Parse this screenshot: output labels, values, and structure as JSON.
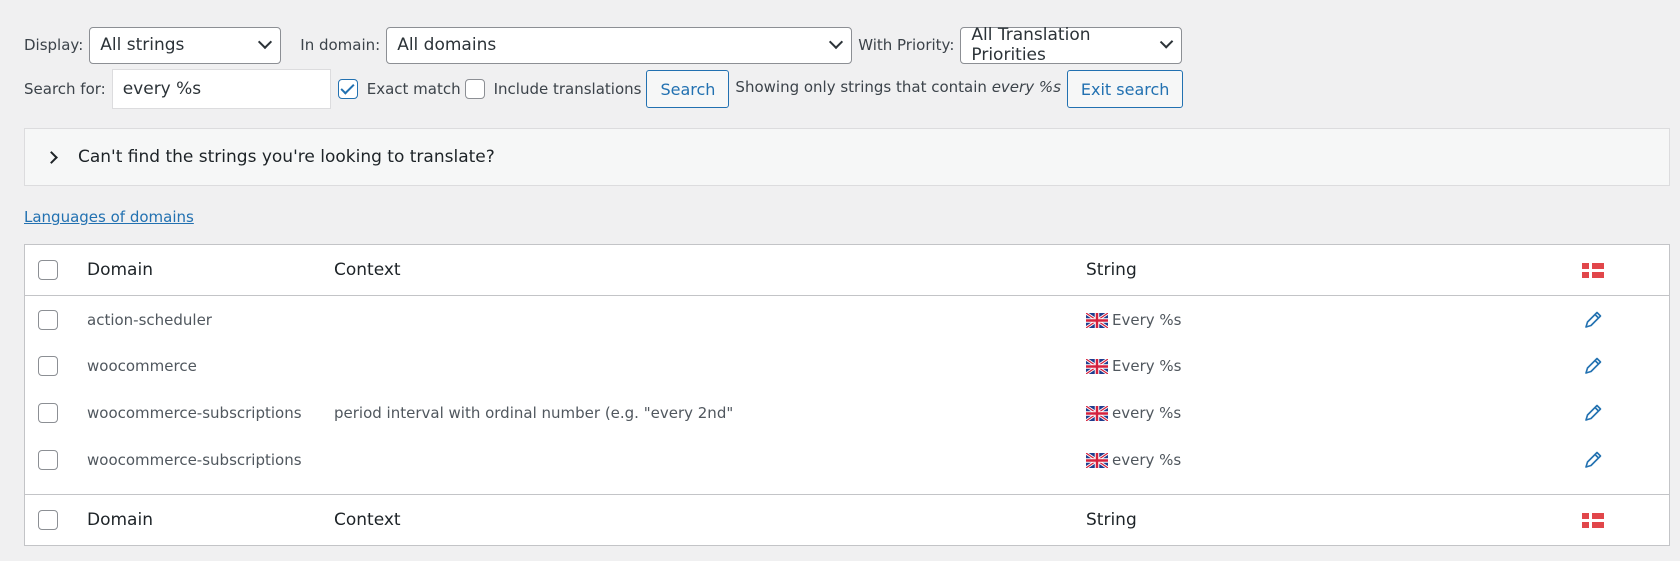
{
  "filters": {
    "display_label": "Display:",
    "display_value": "All strings",
    "domain_label": "In domain:",
    "domain_value": "All domains",
    "priority_label": "With Priority:",
    "priority_value": "All Translation Priorities"
  },
  "search": {
    "label": "Search for:",
    "value": "every %s",
    "exact_match_label": "Exact match",
    "exact_match_checked": true,
    "include_translations_label": "Include translations",
    "include_translations_checked": false,
    "search_button": "Search",
    "showing_prefix": "Showing only strings that contain",
    "showing_term": "every %s",
    "exit_button": "Exit search"
  },
  "help_panel": {
    "text": "Can't find the strings you're looking to translate?"
  },
  "languages_link": "Languages of domains",
  "table": {
    "headers": {
      "domain": "Domain",
      "context": "Context",
      "string": "String"
    },
    "rows": [
      {
        "domain": "action-scheduler",
        "context": "",
        "string": "Every %s"
      },
      {
        "domain": "woocommerce",
        "context": "",
        "string": "Every %s"
      },
      {
        "domain": "woocommerce-subscriptions",
        "context": "period interval with ordinal number (e.g. \"every 2nd\"",
        "string": "every %s"
      },
      {
        "domain": "woocommerce-subscriptions",
        "context": "",
        "string": "every %s"
      }
    ],
    "language_flag_icon": "denmark-flag-icon",
    "source_flag_icon": "uk-flag-icon",
    "edit_icon": "pencil-icon"
  },
  "colors": {
    "accent": "#2271b1",
    "background": "#f0f0f1",
    "flag_red": "#e1464a"
  }
}
